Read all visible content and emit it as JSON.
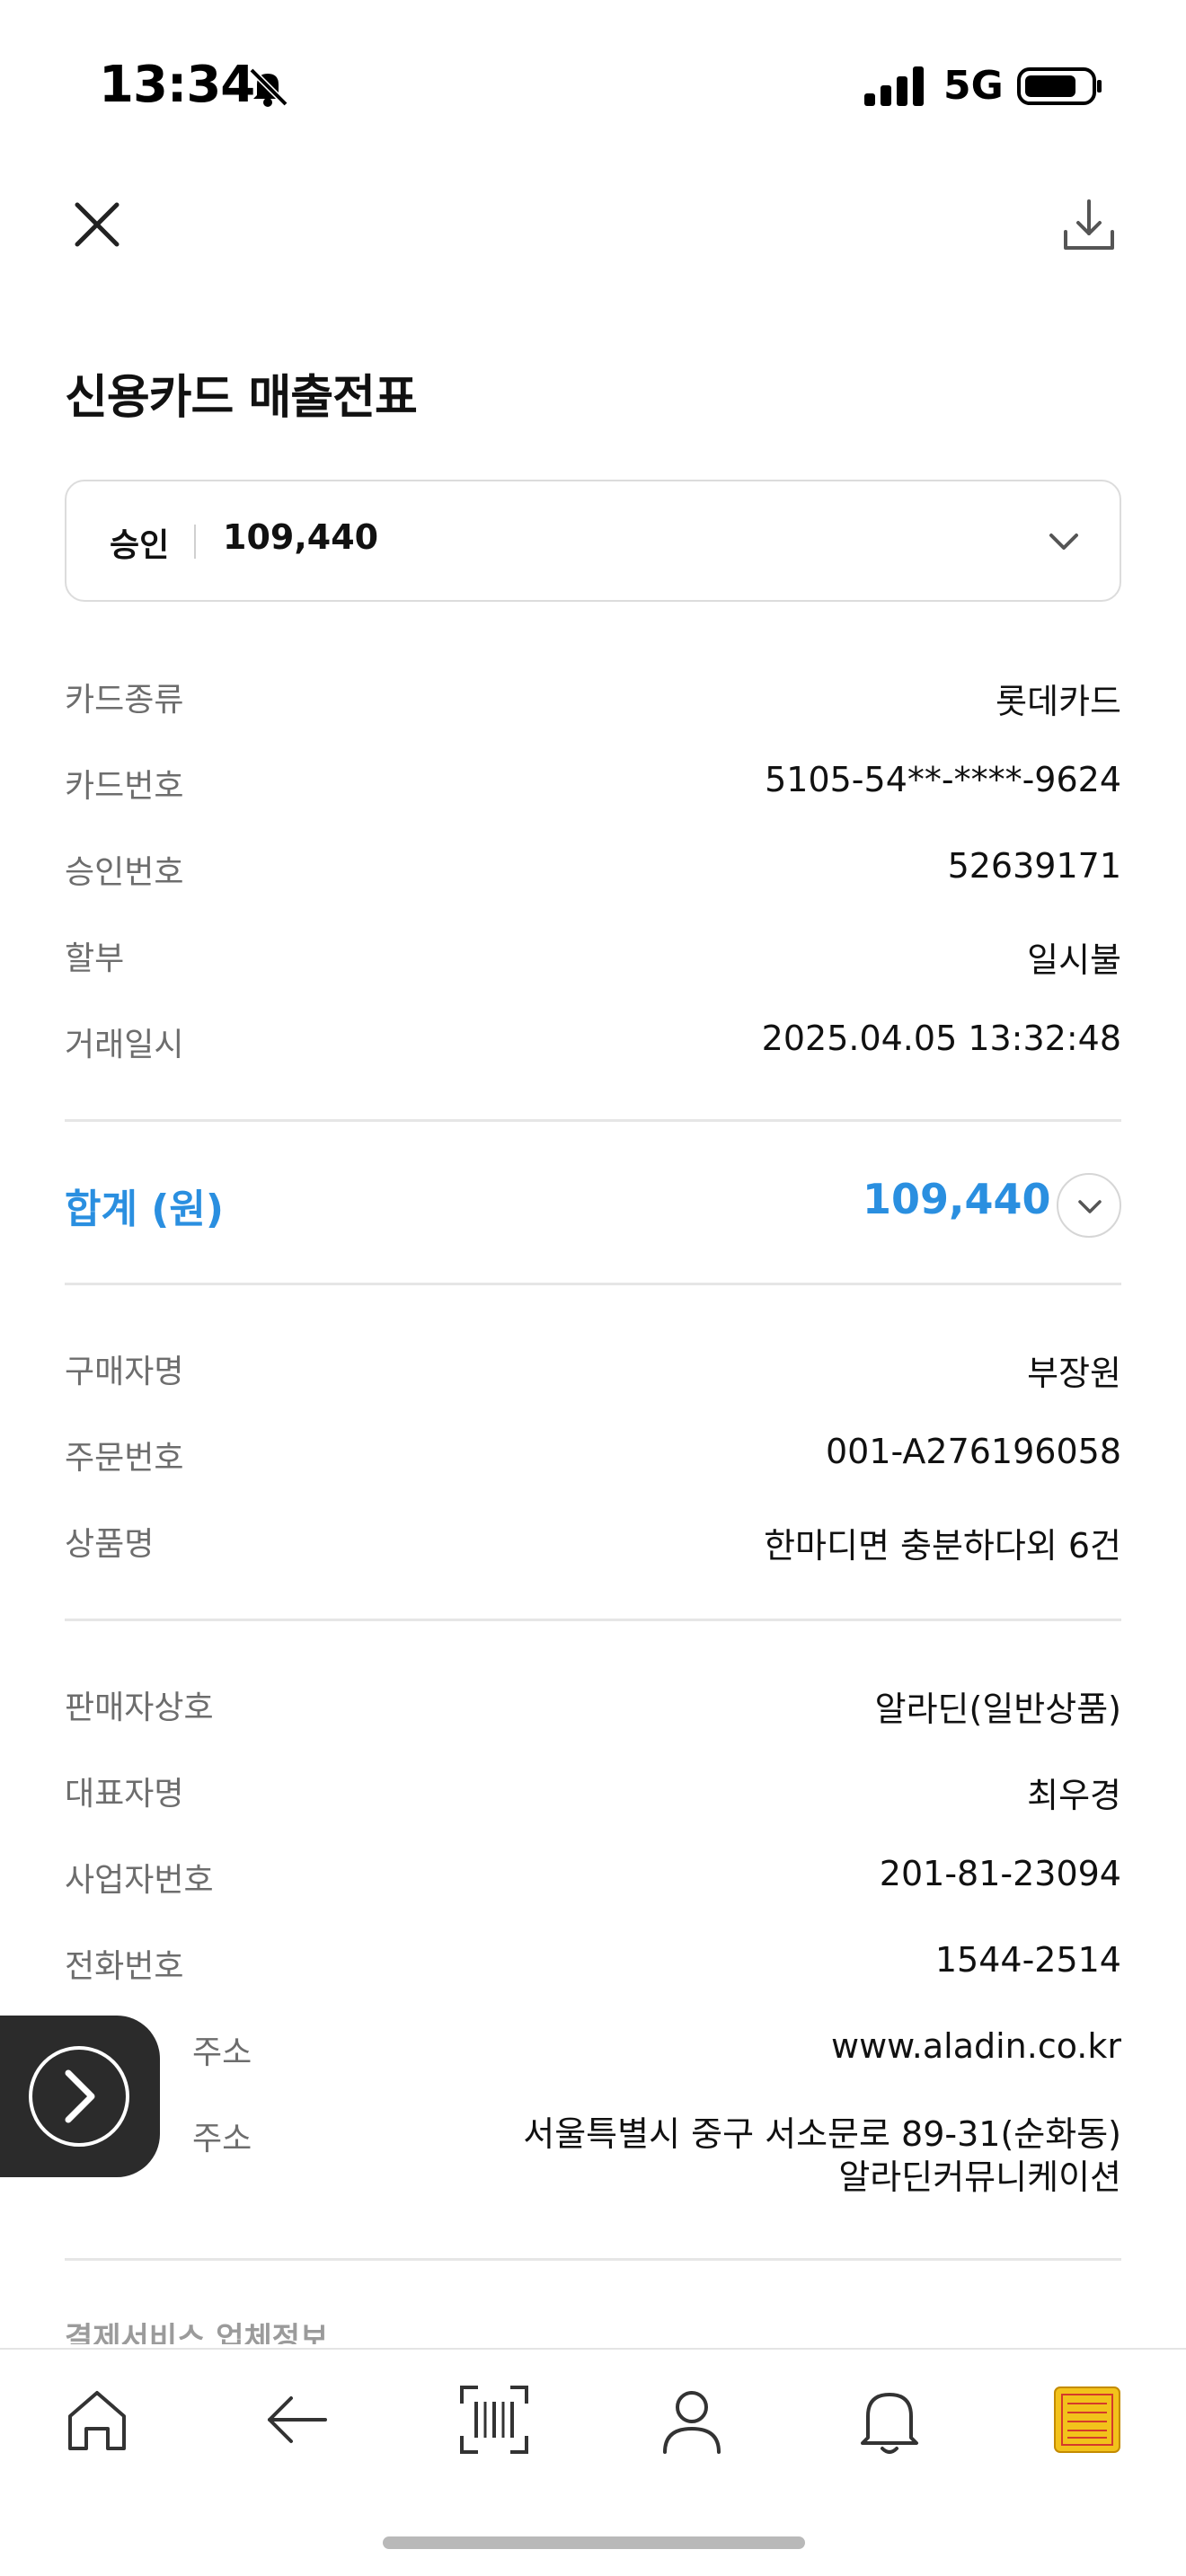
{
  "status_bar": {
    "time": "13:34",
    "network": "5G",
    "icons": [
      "bell-slash-icon",
      "signal-icon",
      "battery-icon"
    ]
  },
  "toolbar": {
    "close_icon": "close-icon",
    "download_icon": "download-icon"
  },
  "title": "신용카드 매출전표",
  "approval": {
    "status": "승인",
    "amount": "109,440"
  },
  "card_info": [
    {
      "label": "카드종류",
      "value": "롯데카드"
    },
    {
      "label": "카드번호",
      "value": "5105-54**-****-9624"
    },
    {
      "label": "승인번호",
      "value": "52639171"
    },
    {
      "label": "할부",
      "value": "일시불"
    },
    {
      "label": "거래일시",
      "value": "2025.04.05 13:32:48"
    }
  ],
  "total": {
    "label": "합계 (원)",
    "amount": "109,440",
    "accent_color": "#2a8fe0"
  },
  "order_info": [
    {
      "label": "구매자명",
      "value": "부장원"
    },
    {
      "label": "주문번호",
      "value": "001-A276196058"
    },
    {
      "label": "상품명",
      "value": "한마디면 충분하다외 6건"
    }
  ],
  "seller_info": [
    {
      "label": "판매자상호",
      "value": "알라딘(일반상품)"
    },
    {
      "label": "대표자명",
      "value": "최우경"
    },
    {
      "label": "사업자번호",
      "value": "201-81-23094"
    },
    {
      "label": "전화번호",
      "value": "1544-2514"
    },
    {
      "label": "주소",
      "value": "www.aladin.co.kr"
    },
    {
      "label": "주소",
      "value_line1": "서울특별시 중구 서소문로 89-31(순화동)",
      "value_line2": "알라딘커뮤니케이션"
    }
  ],
  "next_section": "결제서비스 업체정보",
  "tab_bar": [
    "home-icon",
    "back-arrow-icon",
    "barcode-scan-icon",
    "profile-icon",
    "bell-icon",
    "app-thumbnail-icon"
  ]
}
